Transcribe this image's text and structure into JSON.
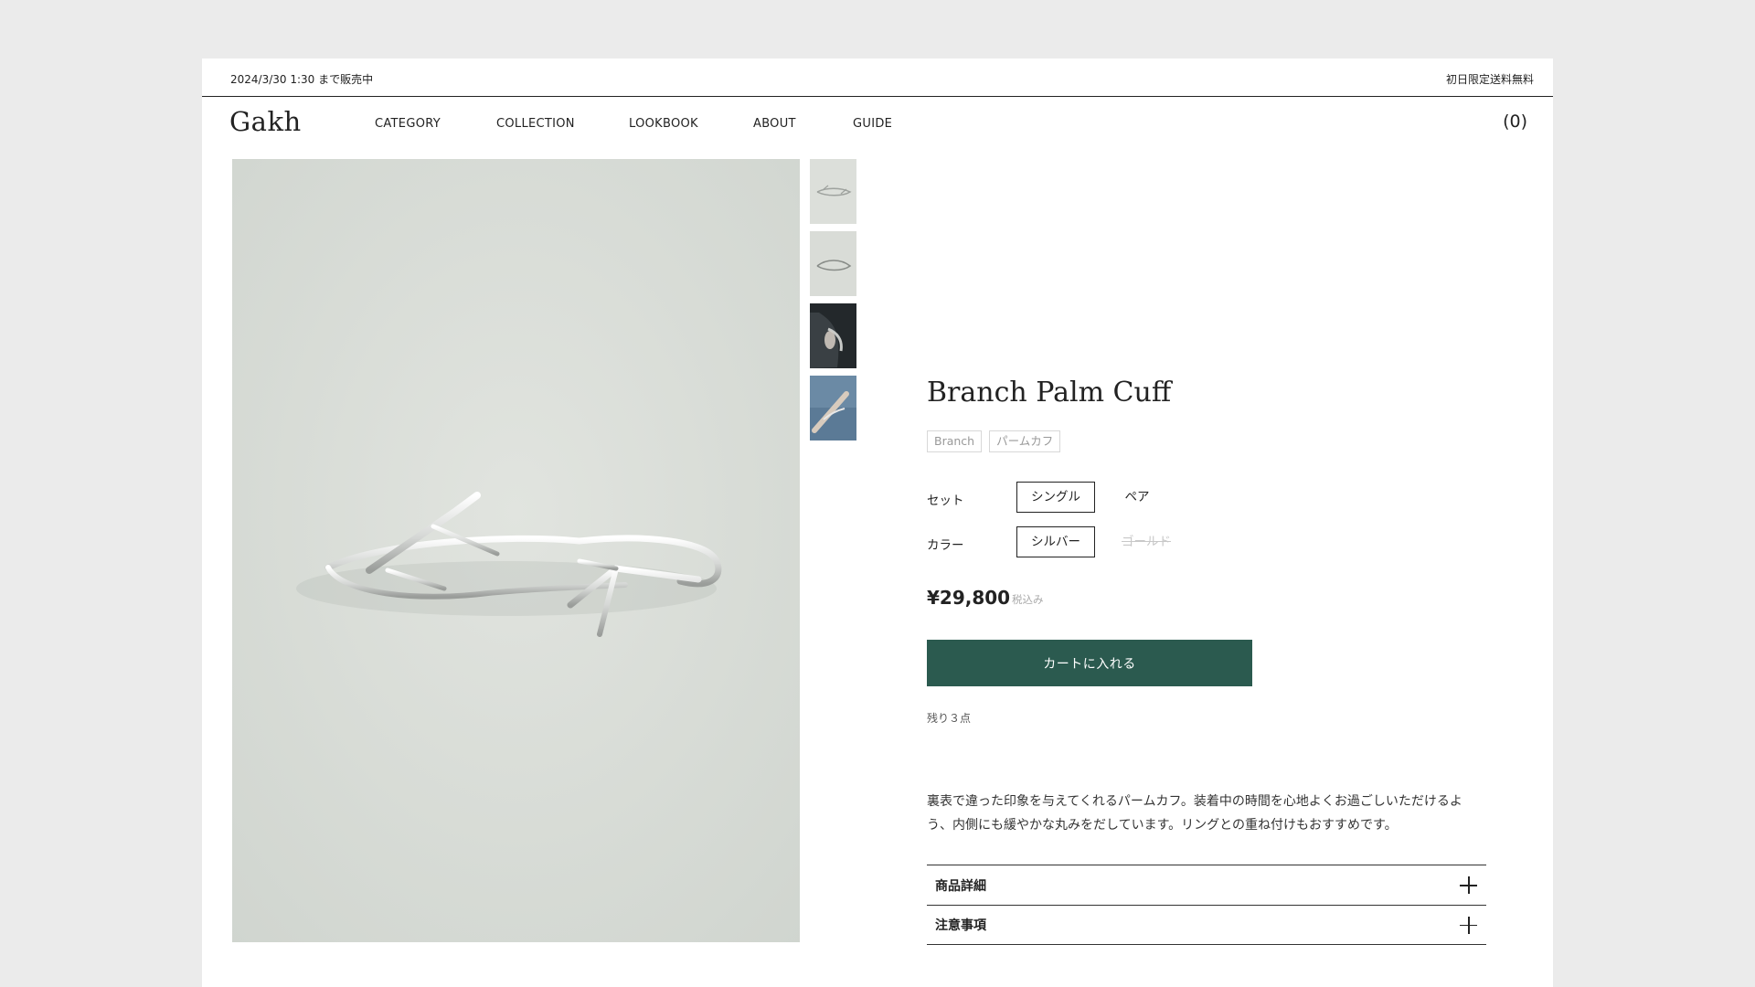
{
  "announcement": {
    "left": "2024/3/30 1:30 まで販売中",
    "right": "初日限定送料無料"
  },
  "header": {
    "logo": "Gakh",
    "nav": [
      "CATEGORY",
      "COLLECTION",
      "LOOKBOOK",
      "ABOUT",
      "GUIDE"
    ],
    "cart": "(0)"
  },
  "gallery": {
    "main_image": "silver-branch-cuff-photo",
    "thumbnails": [
      "cuff-flat-thumb",
      "cuff-side-thumb",
      "cuff-worn-dark-thumb",
      "cuff-worn-blue-thumb"
    ]
  },
  "product": {
    "title": "Branch Palm Cuff",
    "tags": [
      "Branch",
      "パームカフ"
    ],
    "options": [
      {
        "label": "セット",
        "choices": [
          "シングル",
          "ペア"
        ],
        "selected": "シングル"
      },
      {
        "label": "カラー",
        "choices": [
          "シルバー",
          "ゴールド"
        ],
        "selected": "シルバー",
        "disabled": "ゴールド"
      }
    ],
    "price": "¥29,800",
    "tax_note": "税込み",
    "add_to_cart": "カートに入れる",
    "stock": "残り３点",
    "description": "裏表で違った印象を与えてくれるパームカフ。装着中の時間を心地よくお過ごしいただけるよう、内側にも緩やかな丸みをだしています。リングとの重ね付けもおすすめです。",
    "accordions": [
      "商品詳細",
      "注意事項"
    ]
  },
  "colors": {
    "accent": "#2b5a4f",
    "background": "#ebebeb",
    "image_bg": "#d9ddd7"
  }
}
